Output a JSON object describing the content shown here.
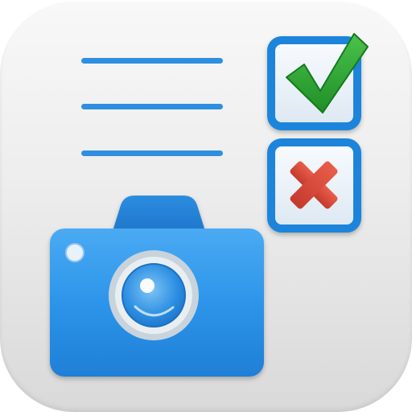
{
  "app_icon": {
    "name": "checklist-camera-app-icon",
    "colors": {
      "tile_top": "#f8f8f8",
      "tile_bottom": "#d9d9d9",
      "line_blue": "#2e8fe0",
      "box_border": "#1f85db",
      "check_green": "#2fa538",
      "cross_red": "#d84a3a",
      "camera_blue": "#2c95eb"
    },
    "icons": [
      "checklist-lines-icon",
      "checked-box-icon",
      "crossed-box-icon",
      "camera-icon"
    ]
  }
}
